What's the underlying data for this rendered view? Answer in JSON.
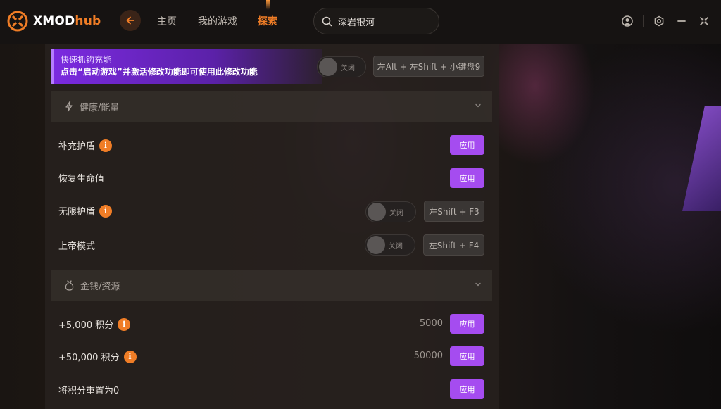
{
  "app": {
    "logo_x": "XMOD",
    "logo_hub": "hub",
    "brand_color": "#f07d26",
    "accent_purple": "#a54cf0"
  },
  "nav": {
    "home": "主页",
    "my_games": "我的游戏",
    "explore": "探索"
  },
  "search": {
    "value": "深岩银河"
  },
  "banner": {
    "line1": "快速抓钩充能",
    "line2": "点击“启动游戏”并激活修改功能即可使用此修改功能",
    "toggle_label": "关闭",
    "hotkey": "左Alt + 左Shift + 小键盘9"
  },
  "sections": {
    "health": {
      "label": "健康/能量",
      "icon": "lightning-icon"
    },
    "money": {
      "label": "金钱/资源",
      "icon": "money-bag-icon"
    }
  },
  "rows": {
    "refill_shield": {
      "label": "补充护盾",
      "button": "应用"
    },
    "restore_health": {
      "label": "恢复生命值",
      "button": "应用"
    },
    "infinite_shield": {
      "label": "无限护盾",
      "toggle_label": "关闭",
      "hotkey": "左Shift + F3"
    },
    "god_mode": {
      "label": "上帝模式",
      "toggle_label": "关闭",
      "hotkey": "左Shift + F4"
    },
    "plus_5000": {
      "label": "+5,000 积分",
      "value": "5000",
      "button": "应用"
    },
    "plus_50000": {
      "label": "+50,000 积分",
      "value": "50000",
      "button": "应用"
    },
    "reset_points": {
      "label": "将积分重置为0",
      "button": "应用"
    }
  },
  "info_glyph": "i"
}
